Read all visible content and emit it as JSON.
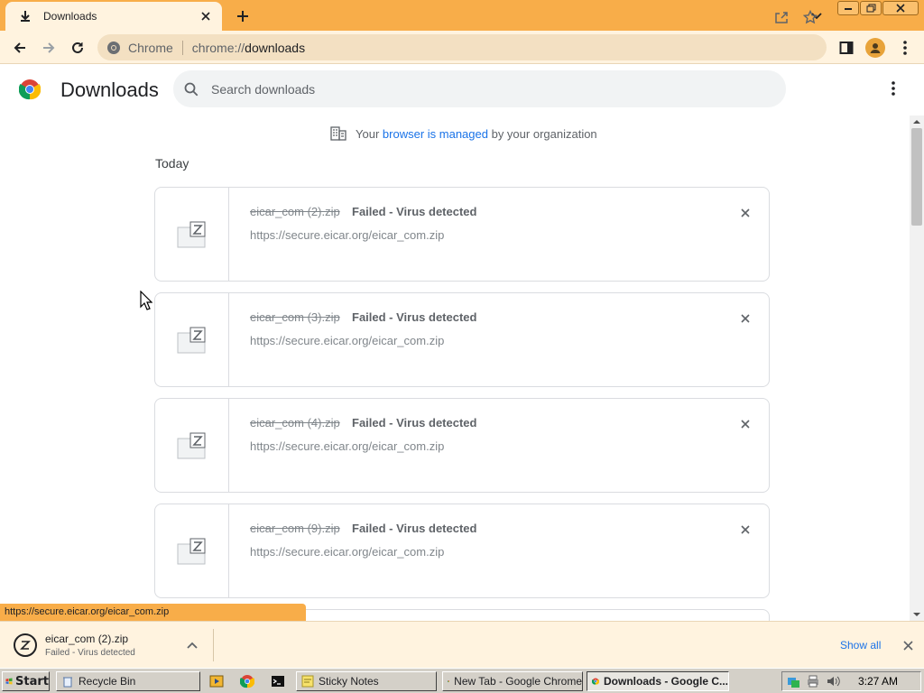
{
  "tab": {
    "title": "Downloads"
  },
  "toolbar": {
    "site_label": "Chrome",
    "url_scheme": "chrome://",
    "url_host": "downloads"
  },
  "page": {
    "title": "Downloads",
    "search_placeholder": "Search downloads",
    "managed_prefix": "Your",
    "managed_link": "browser is managed",
    "managed_suffix": "by your organization",
    "section": "Today"
  },
  "downloads": [
    {
      "filename": "eicar_com (2).zip",
      "status": "Failed - Virus detected",
      "url": "https://secure.eicar.org/eicar_com.zip"
    },
    {
      "filename": "eicar_com (3).zip",
      "status": "Failed - Virus detected",
      "url": "https://secure.eicar.org/eicar_com.zip"
    },
    {
      "filename": "eicar_com (4).zip",
      "status": "Failed - Virus detected",
      "url": "https://secure.eicar.org/eicar_com.zip"
    },
    {
      "filename": "eicar_com (9).zip",
      "status": "Failed - Virus detected",
      "url": "https://secure.eicar.org/eicar_com.zip"
    }
  ],
  "status_bubble": "https://secure.eicar.org/eicar_com.zip",
  "shelf": {
    "filename": "eicar_com (2).zip",
    "status": "Failed - Virus detected",
    "show_all": "Show all"
  },
  "taskbar": {
    "start": "Start",
    "tasks": [
      "Recycle Bin",
      "Sticky Notes",
      "New Tab - Google Chrome",
      "Downloads - Google C..."
    ],
    "clock": "3:27 AM"
  },
  "colors": {
    "frame": "#f8ad49",
    "toolbar": "#fff3df",
    "link": "#1a73e8"
  }
}
